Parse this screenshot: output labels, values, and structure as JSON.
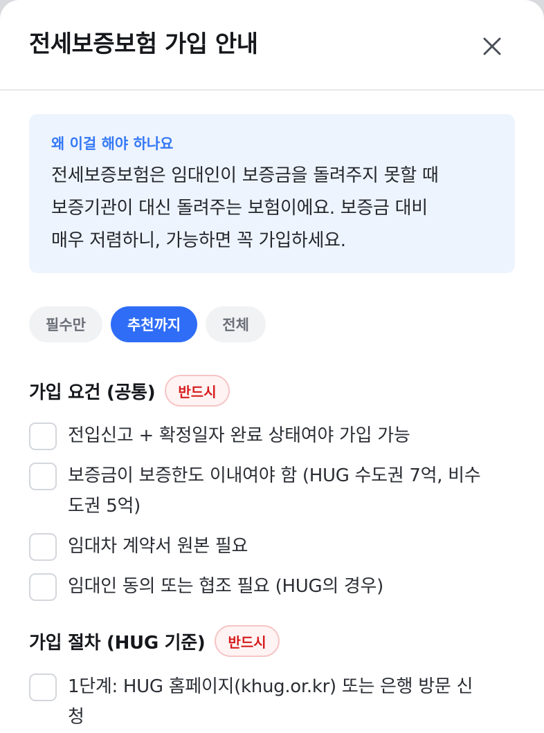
{
  "dialog": {
    "title": "전세보증보험 가입 안내",
    "close_icon": "close-icon"
  },
  "info": {
    "label": "왜 이걸 해야 하나요",
    "lines": [
      "전세보증보험은 임대인이 보증금을 돌려주지 못할 때",
      "보증기관이 대신 돌려주는 보험이에요. 보증금 대비",
      "매우 저렴하니, 가능하면 꼭 가입하세요."
    ]
  },
  "filters": {
    "options": [
      "필수만",
      "추천까지",
      "전체"
    ],
    "selected": "추천까지"
  },
  "colors": {
    "accent": "#2f6df6",
    "info_label": "#3478f6",
    "info_bg": "#eef4fd",
    "badge_text": "#d61c1c",
    "badge_bg": "#fff3f3"
  },
  "sections": [
    {
      "title": "가입 요건 (공통)",
      "badge": "반드시",
      "items": [
        "전입신고 + 확정일자 완료 상태여야 가입 가능",
        "보증금이 보증한도 이내여야 함 (HUG 수도권 7억, 비수도권 5억)",
        "임대차 계약서 원본 필요",
        "임대인 동의 또는 협조 필요 (HUG의 경우)"
      ]
    },
    {
      "title": "가입 절차 (HUG 기준)",
      "badge": "반드시",
      "items": [
        "1단계: HUG 홈페이지(khug.or.kr) 또는 은행 방문 신청"
      ]
    }
  ]
}
